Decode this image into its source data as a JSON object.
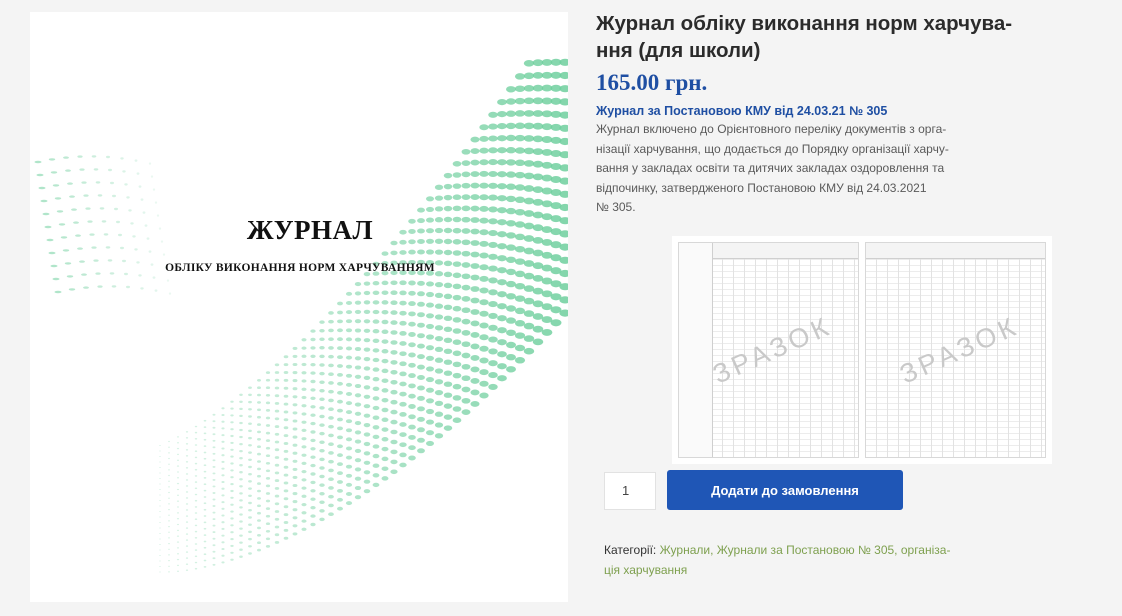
{
  "cover": {
    "title": "ЖУРНАЛ",
    "subtitle": "ОБЛІКУ ВИКОНАННЯ НОРМ ХАРЧУВАННЯМ",
    "accent_color": "#6fcf9e"
  },
  "product": {
    "title_line1": "Журнал обліку виконання норм харчува-",
    "title_line2": "ння (для школи)",
    "price": "165.00 грн.",
    "desc_title": "Журнал за Постановою КМУ від 24.03.21 № 305",
    "desc_lines": [
      "Журнал включено до Орієнтовного переліку документів з орга-",
      "нізації харчування, що додається до Порядку організації харчу-",
      "вання у закладах освіти та дитячих закладах оздоровлення та",
      "відпочинку, затвердженого Постановою КМУ від 24.03.2021",
      "№ 305."
    ]
  },
  "sample": {
    "watermark_left": "ЗРАЗОК",
    "watermark_right": "ЗРАЗОК"
  },
  "cart": {
    "quantity": "1",
    "add_label": "Додати до замовлення",
    "button_color": "#1f56b6"
  },
  "categories": {
    "label": "Категорії:",
    "line1_links": "Журнали, Журнали за Постановою № 305, організа-",
    "line2_links": "ція харчування",
    "link_color": "#7ea04f"
  }
}
